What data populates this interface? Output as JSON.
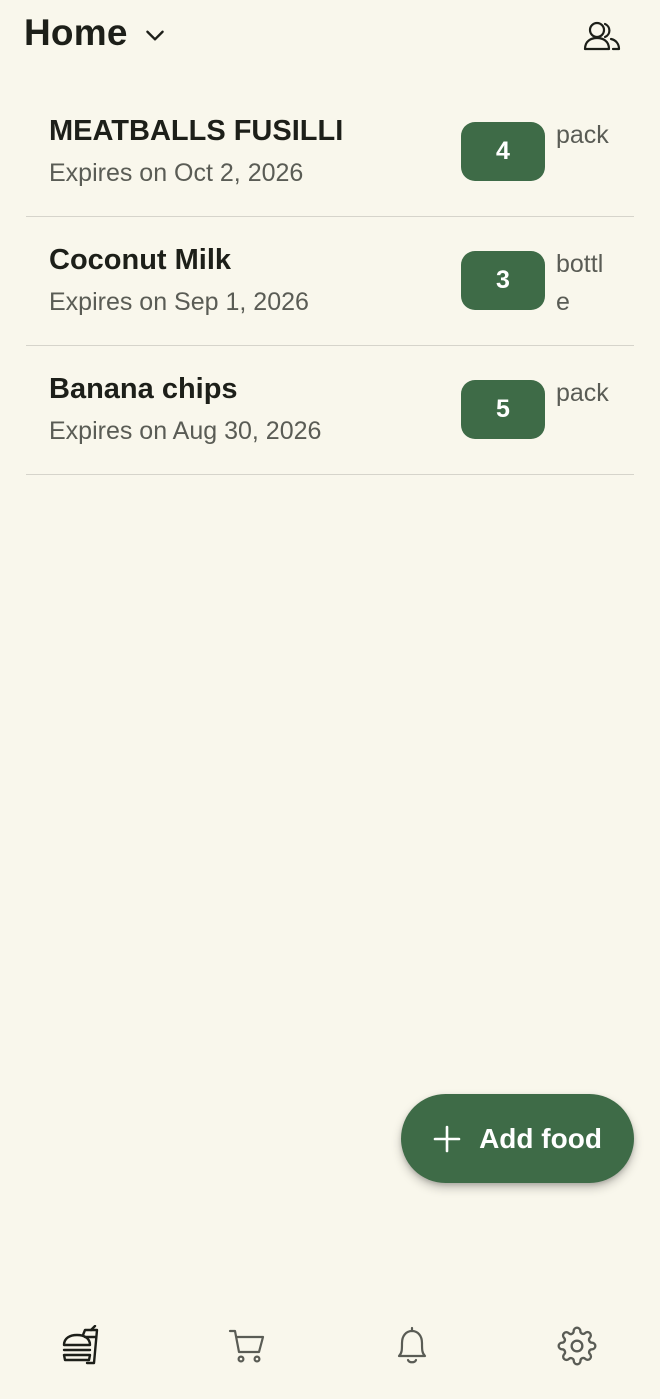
{
  "header": {
    "title": "Home",
    "dropdown_icon": "chevron-down-icon",
    "members_icon": "people-icon"
  },
  "items": [
    {
      "name": "MEATBALLS FUSILLI",
      "expires": "Expires on Oct 2, 2026",
      "quantity": "4",
      "unit": "pack"
    },
    {
      "name": "Coconut Milk",
      "expires": "Expires on Sep 1, 2026",
      "quantity": "3",
      "unit": "bottle"
    },
    {
      "name": "Banana chips",
      "expires": "Expires on Aug 30, 2026",
      "quantity": "5",
      "unit": "pack"
    }
  ],
  "fab": {
    "label": "Add food",
    "icon": "plus-icon"
  },
  "bottom_nav": [
    {
      "id": "food",
      "icon": "food-icon",
      "active": true
    },
    {
      "id": "shopping",
      "icon": "cart-icon",
      "active": false
    },
    {
      "id": "notifications",
      "icon": "bell-icon",
      "active": false
    },
    {
      "id": "settings",
      "icon": "gear-icon",
      "active": false
    }
  ],
  "colors": {
    "background": "#f9f7ec",
    "accent": "#3e6b47",
    "text_primary": "#1d1f19",
    "text_secondary": "#5a5c55"
  }
}
